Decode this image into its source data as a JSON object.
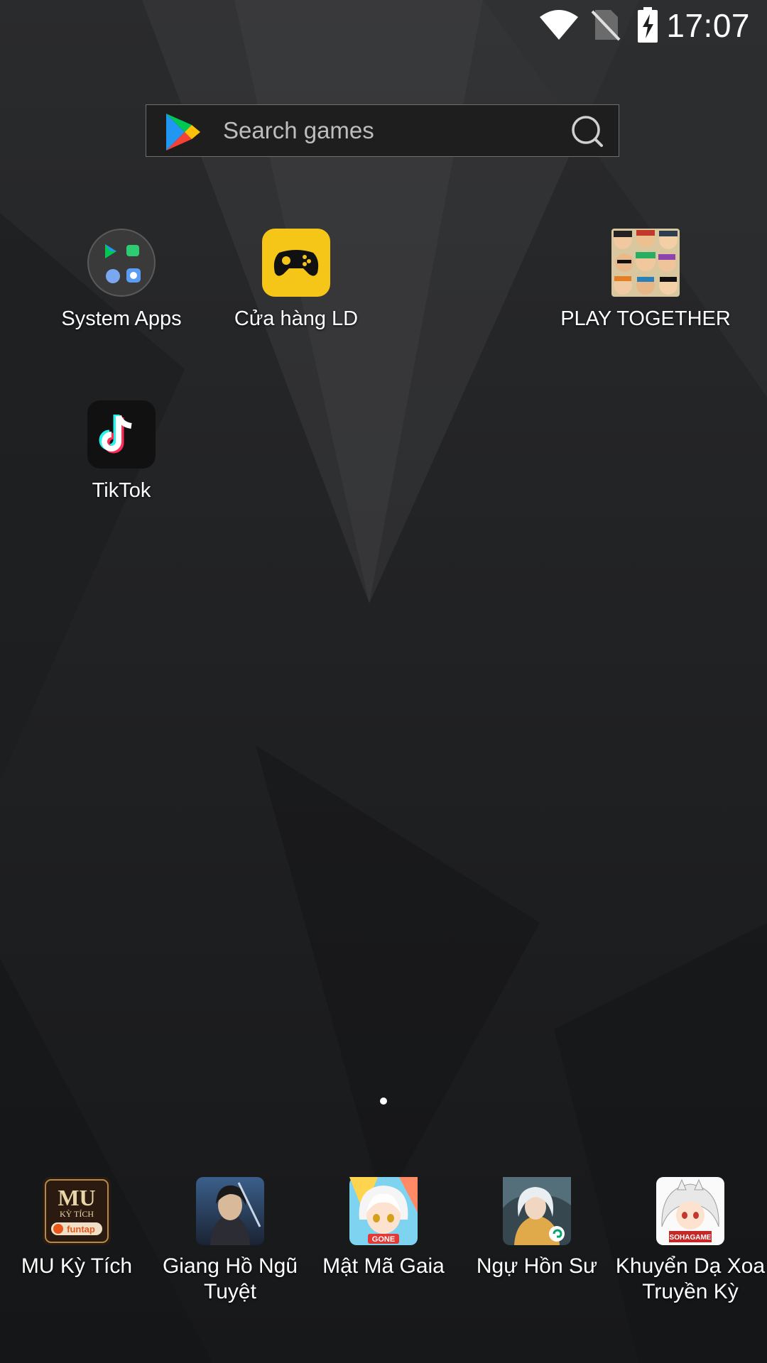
{
  "status_bar": {
    "time": "17:07",
    "icons": [
      "wifi-icon",
      "no-sim-icon",
      "battery-charging-icon"
    ]
  },
  "search": {
    "placeholder": "Search games",
    "logo": "play-store-logo",
    "button_icon": "search-icon"
  },
  "home_apps": [
    {
      "label": "System Apps",
      "icon": "folder-icon"
    },
    {
      "label": "Cửa hàng LD",
      "icon": "gamepad-icon",
      "color": "#f5c518"
    },
    {
      "label": "PLAY TOGETHER",
      "icon": "play-together-icon"
    },
    {
      "label": "TikTok",
      "icon": "tiktok-icon"
    }
  ],
  "dock_apps": [
    {
      "label": "MU Kỳ Tích",
      "icon": "mu-ky-tich-icon"
    },
    {
      "label": "Giang Hồ Ngũ Tuyệt",
      "icon": "giang-ho-ngu-tuyet-icon"
    },
    {
      "label": "Mật Mã Gaia",
      "icon": "mat-ma-gaia-icon"
    },
    {
      "label": "Ngự Hồn Sư",
      "icon": "ngu-hon-su-icon"
    },
    {
      "label": "Khuyển Dạ Xoa Truyền Kỳ",
      "icon": "khuyen-da-xoa-icon"
    }
  ],
  "icon_text": {
    "mu": "MU",
    "ky_tich": "KỲ TÍCH",
    "funtap": "funtap",
    "gone": "GONE",
    "sohagame": "SOHAGAME"
  },
  "pager": {
    "pages": 1,
    "current": 1
  }
}
